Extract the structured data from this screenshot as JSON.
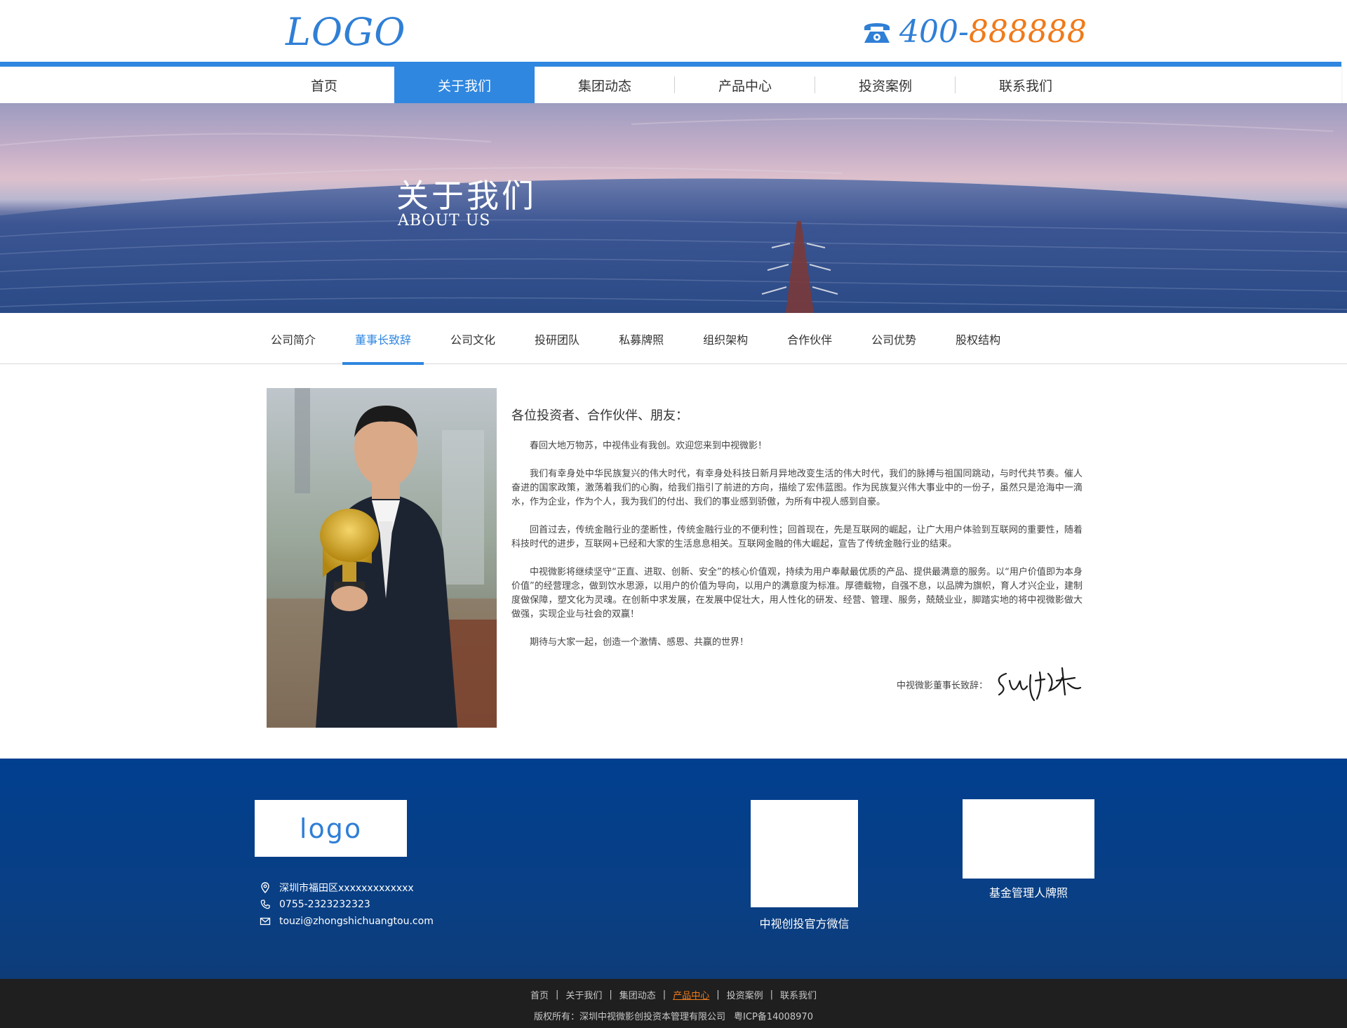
{
  "header": {
    "logo": "LOGO",
    "phone_prefix": "400-",
    "phone_number": "888888",
    "phone_icon": "telephone-icon"
  },
  "nav": {
    "items": [
      {
        "label": "首页"
      },
      {
        "label": "关于我们",
        "active": true
      },
      {
        "label": "集团动态"
      },
      {
        "label": "产品中心"
      },
      {
        "label": "投资案例"
      },
      {
        "label": "联系我们"
      }
    ]
  },
  "banner": {
    "title": "关于我们",
    "subtitle": "ABOUT US"
  },
  "subtabs": {
    "items": [
      {
        "label": "公司简介"
      },
      {
        "label": "董事长致辞",
        "active": true
      },
      {
        "label": "公司文化"
      },
      {
        "label": "投研团队"
      },
      {
        "label": "私募牌照"
      },
      {
        "label": "组织架构"
      },
      {
        "label": "合作伙伴"
      },
      {
        "label": "公司优势"
      },
      {
        "label": "股权结构"
      }
    ]
  },
  "content": {
    "greeting": "各位投资者、合作伙伴、朋友：",
    "paragraphs": [
      "春回大地万物苏，中视伟业有我创。欢迎您来到中视微影！",
      "我们有幸身处中华民族复兴的伟大时代，有幸身处科技日新月异地改变生活的伟大时代，我们的脉搏与祖国同跳动，与时代共节奏。催人奋进的国家政策，激荡着我们的心胸，给我们指引了前进的方向，描绘了宏伟蓝图。作为民族复兴伟大事业中的一份子，虽然只是沧海中一滴水，作为企业，作为个人，我为我们的付出、我们的事业感到骄傲，为所有中视人感到自豪。",
      "回首过去，传统金融行业的垄断性，传统金融行业的不便利性；回首现在，先是互联网的崛起，让广大用户体验到互联网的重要性，随着科技时代的进步，互联网+已经和大家的生活息息相关。互联网金融的伟大崛起，宣告了传统金融行业的结束。",
      "中视微影将继续坚守“正直、进取、创新、安全”的核心价值观，持续为用户奉献最优质的产品、提供最满意的服务。以“用户价值即为本身价值”的经营理念，做到饮水思源，以用户的价值为导向，以用户的满意度为标准。厚德载物，自强不息，以品牌为旗帜，育人才兴企业，建制度做保障，塑文化为灵魂。在创新中求发展，在发展中促壮大，用人性化的研发、经营、管理、服务，兢兢业业，脚踏实地的将中视微影做大做强，实现企业与社会的双赢！",
      "期待与大家一起，创造一个激情、感恩、共赢的世界！"
    ],
    "signature_label": "中视微影董事长致辞："
  },
  "footer": {
    "logo": "logo",
    "address": "深圳市福田区xxxxxxxxxxxxx",
    "phone": "0755-2323232323",
    "email": "touzi@zhongshichuangtou.com",
    "qr_wechat_label": "中视创投官方微信",
    "license_label": "基金管理人牌照"
  },
  "bottombar": {
    "links": [
      {
        "label": "首页"
      },
      {
        "label": "关于我们"
      },
      {
        "label": "集团动态"
      },
      {
        "label": "产品中心",
        "active": true
      },
      {
        "label": "投资案例"
      },
      {
        "label": "联系我们"
      }
    ],
    "copyright": "版权所有：深圳中视微影创投资本管理有限公司",
    "icp": "粤ICP备14008970"
  },
  "colors": {
    "accent": "#2f87e0",
    "phone_highlight": "#f07a1a",
    "footer_bg": "#0a3f83",
    "bottom_bg": "#1f1f1f"
  }
}
